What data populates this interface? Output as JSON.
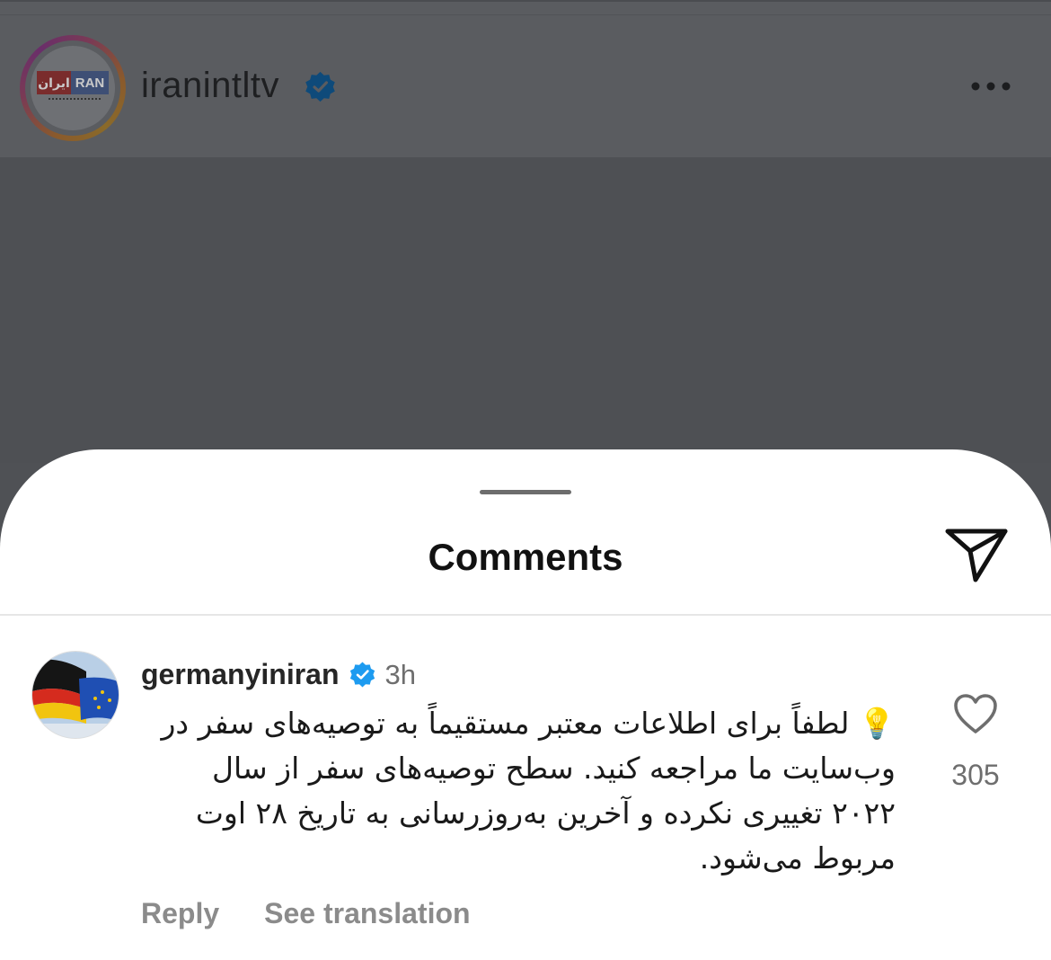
{
  "post": {
    "username": "iranintltv",
    "logo_text_red": "ایران",
    "logo_text_blue": "RAN"
  },
  "sheet": {
    "title": "Comments"
  },
  "comment": {
    "username": "germanyiniran",
    "time": "3h",
    "emoji": "💡",
    "text": "لطفاً برای اطلاعات معتبر مستقیماً به توصیه‌های سفر در وب‌سایت ما مراجعه کنید. سطح توصیه‌های سفر از سال ۲۰۲۲ تغییری نکرده و آخرین به‌روزرسانی به تاریخ ۲۸ اوت مربوط می‌شود.",
    "reply_label": "Reply",
    "translate_label": "See translation",
    "like_count": "305"
  },
  "colors": {
    "verified": "#1d9bf0",
    "overlay": "#4f5155",
    "muted_text": "#8b8b8b"
  },
  "icons": [
    "verified-badge-icon",
    "more-options-icon",
    "share-direct-icon",
    "heart-icon"
  ]
}
